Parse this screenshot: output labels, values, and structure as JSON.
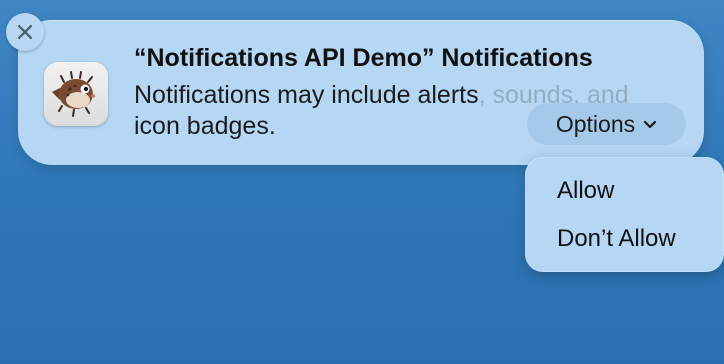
{
  "notification": {
    "title": "“Notifications API Demo” Notifications",
    "body_start": "Notifications may include alerts",
    "body_faded": ", sounds, and",
    "body_end": "icon badges.",
    "options_label": "Options"
  },
  "menu": {
    "items": [
      {
        "label": "Allow"
      },
      {
        "label": "Don’t Allow"
      }
    ]
  },
  "icons": {
    "close": "close-icon",
    "app": "pufferfish-app-icon",
    "chevron": "chevron-down-icon"
  },
  "colors": {
    "background": "#3079b8",
    "card": "#b5d7f3",
    "button": "#a5c9e8"
  }
}
